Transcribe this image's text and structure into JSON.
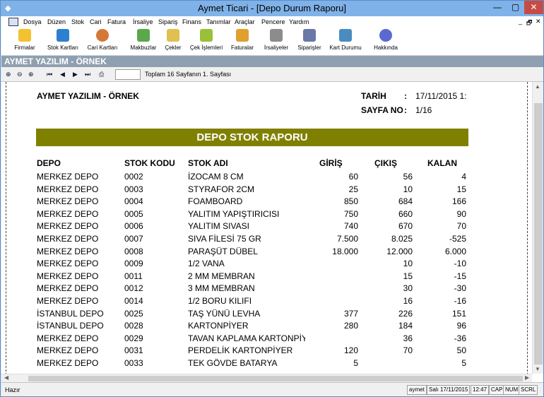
{
  "window": {
    "title": "Aymet Ticari - [Depo Durum Raporu]",
    "min": "—",
    "max": "▢",
    "close": "✕"
  },
  "menu": [
    "Dosya",
    "Düzen",
    "Stok",
    "Cari",
    "Fatura",
    "İrsaliye",
    "Sipariş",
    "Finans",
    "Tanımlar",
    "Araçlar",
    "Pencere",
    "Yardım"
  ],
  "mdi_controls": [
    "_",
    "🗗",
    "✕"
  ],
  "toolbar": [
    {
      "label": "Firmalar",
      "icon": "folder-icon",
      "color": "#f2c230"
    },
    {
      "label": "Stok Kartları",
      "icon": "box-icon",
      "color": "#2f7fd0"
    },
    {
      "label": "Cari Kartları",
      "icon": "users-icon",
      "color": "#d4783a"
    },
    {
      "label": "Makbuzlar",
      "icon": "receipt-icon",
      "color": "#5aa84a"
    },
    {
      "label": "Çekler",
      "icon": "cheque-icon",
      "color": "#e0c050"
    },
    {
      "label": "Çek İşlemleri",
      "icon": "pen-cheque-icon",
      "color": "#9ac03a"
    },
    {
      "label": "Faturalar",
      "icon": "invoice-icon",
      "color": "#e0a030"
    },
    {
      "label": "İrsaliyeler",
      "icon": "waybill-icon",
      "color": "#8c8c8c"
    },
    {
      "label": "Siparişler",
      "icon": "order-icon",
      "color": "#6a78a8"
    },
    {
      "label": "Kart Durumu",
      "icon": "card-status-icon",
      "color": "#4a8cc0"
    },
    {
      "label": "Hakkında",
      "icon": "info-icon",
      "color": "#5a6ad0"
    }
  ],
  "company_bar": "AYMET YAZILIM - ÖRNEK",
  "nav": {
    "icons": [
      "zoom-fit-icon",
      "zoom-out-icon",
      "zoom-in-icon",
      "first-page-icon",
      "prev-page-icon",
      "next-page-icon",
      "last-page-icon",
      "print-icon"
    ],
    "page_value": "",
    "page_info": "Toplam 16 Sayfanın 1. Sayfası"
  },
  "report": {
    "company": "AYMET YAZILIM - ÖRNEK",
    "date_label": "TARİH",
    "date_value": "17/11/2015 1:",
    "page_label": "SAYFA NO",
    "page_value": "1/16",
    "colon": ":",
    "title": "DEPO STOK RAPORU",
    "headers": {
      "depo": "DEPO",
      "kod": "STOK KODU",
      "adi": "STOK ADI",
      "giris": "GİRİŞ",
      "cikis": "ÇIKIŞ",
      "kalan": "KALAN"
    },
    "rows": [
      {
        "depo": "MERKEZ DEPO",
        "kod": "0002",
        "adi": "İZOCAM  8 CM",
        "giris": "60",
        "cikis": "56",
        "kalan": "4"
      },
      {
        "depo": "MERKEZ DEPO",
        "kod": "0003",
        "adi": "STYRAFOR 2CM",
        "giris": "25",
        "cikis": "10",
        "kalan": "15"
      },
      {
        "depo": "MERKEZ DEPO",
        "kod": "0004",
        "adi": "FOAMBOARD",
        "giris": "850",
        "cikis": "684",
        "kalan": "166"
      },
      {
        "depo": "MERKEZ DEPO",
        "kod": "0005",
        "adi": "YALITIM YAPIŞTIRICISI",
        "giris": "750",
        "cikis": "660",
        "kalan": "90"
      },
      {
        "depo": "MERKEZ DEPO",
        "kod": "0006",
        "adi": "YALITIM SIVASI",
        "giris": "740",
        "cikis": "670",
        "kalan": "70"
      },
      {
        "depo": "MERKEZ DEPO",
        "kod": "0007",
        "adi": "SIVA FİLESİ 75 GR",
        "giris": "7.500",
        "cikis": "8.025",
        "kalan": "-525"
      },
      {
        "depo": "MERKEZ DEPO",
        "kod": "0008",
        "adi": "PARAŞÜT DÜBEL",
        "giris": "18.000",
        "cikis": "12.000",
        "kalan": "6.000"
      },
      {
        "depo": "MERKEZ DEPO",
        "kod": "0009",
        "adi": "1/2 VANA",
        "giris": "",
        "cikis": "10",
        "kalan": "-10"
      },
      {
        "depo": "MERKEZ DEPO",
        "kod": "0011",
        "adi": "2 MM MEMBRAN",
        "giris": "",
        "cikis": "15",
        "kalan": "-15"
      },
      {
        "depo": "MERKEZ DEPO",
        "kod": "0012",
        "adi": "3 MM MEMBRAN",
        "giris": "",
        "cikis": "30",
        "kalan": "-30"
      },
      {
        "depo": "MERKEZ DEPO",
        "kod": "0014",
        "adi": "1/2 BORU KILIFI",
        "giris": "",
        "cikis": "16",
        "kalan": "-16"
      },
      {
        "depo": "İSTANBUL DEPO",
        "kod": "0025",
        "adi": "TAŞ YÜNÜ LEVHA",
        "giris": "377",
        "cikis": "226",
        "kalan": "151"
      },
      {
        "depo": "İSTANBUL DEPO",
        "kod": "0028",
        "adi": "KARTONPİYER",
        "giris": "280",
        "cikis": "184",
        "kalan": "96"
      },
      {
        "depo": "MERKEZ DEPO",
        "kod": "0029",
        "adi": "TAVAN KAPLAMA KARTONPİYER",
        "giris": "",
        "cikis": "36",
        "kalan": "-36"
      },
      {
        "depo": "MERKEZ DEPO",
        "kod": "0031",
        "adi": "PERDELİK KARTONPİYER",
        "giris": "120",
        "cikis": "70",
        "kalan": "50"
      },
      {
        "depo": "MERKEZ DEPO",
        "kod": "0033",
        "adi": "TEK GÖVDE BATARYA",
        "giris": "5",
        "cikis": "",
        "kalan": "5"
      }
    ]
  },
  "status": {
    "left": "Hazır",
    "user": "aymet",
    "date": "Salı 17/11/2015",
    "time": "12:47",
    "caps": "CAP",
    "num": "NUM",
    "scrl": "SCRL"
  }
}
